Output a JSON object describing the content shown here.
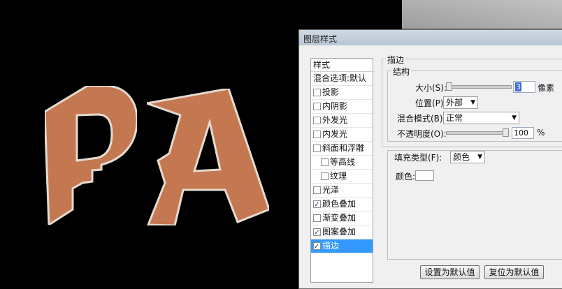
{
  "artwork": {
    "letters": "PA"
  },
  "dialog": {
    "title": "图层样式",
    "styles_header": "样式",
    "items": [
      {
        "label": "混合选项:默认",
        "checkbox": false,
        "checked": false,
        "sub": false,
        "selected": false
      },
      {
        "label": "投影",
        "checkbox": true,
        "checked": false,
        "sub": false,
        "selected": false
      },
      {
        "label": "内阴影",
        "checkbox": true,
        "checked": false,
        "sub": false,
        "selected": false
      },
      {
        "label": "外发光",
        "checkbox": true,
        "checked": false,
        "sub": false,
        "selected": false
      },
      {
        "label": "内发光",
        "checkbox": true,
        "checked": false,
        "sub": false,
        "selected": false
      },
      {
        "label": "斜面和浮雕",
        "checkbox": true,
        "checked": false,
        "sub": false,
        "selected": false
      },
      {
        "label": "等高线",
        "checkbox": true,
        "checked": false,
        "sub": true,
        "selected": false
      },
      {
        "label": "纹理",
        "checkbox": true,
        "checked": false,
        "sub": true,
        "selected": false
      },
      {
        "label": "光泽",
        "checkbox": true,
        "checked": false,
        "sub": false,
        "selected": false
      },
      {
        "label": "颜色叠加",
        "checkbox": true,
        "checked": true,
        "sub": false,
        "selected": false
      },
      {
        "label": "渐变叠加",
        "checkbox": true,
        "checked": false,
        "sub": false,
        "selected": false
      },
      {
        "label": "图案叠加",
        "checkbox": true,
        "checked": true,
        "sub": false,
        "selected": false
      },
      {
        "label": "描边",
        "checkbox": true,
        "checked": true,
        "sub": false,
        "selected": true
      }
    ],
    "stroke": {
      "section_title": "描边",
      "structure_title": "结构",
      "size_label": "大小(S):",
      "size_value": "3",
      "size_unit": "像素",
      "size_fraction": 0.03,
      "position_label": "位置(P):",
      "position_value": "外部",
      "blend_label": "混合模式(B):",
      "blend_value": "正常",
      "opacity_label": "不透明度(O):",
      "opacity_value": "100",
      "opacity_unit": "%",
      "opacity_fraction": 1.0,
      "fill_type_label": "填充类型(F):",
      "fill_type_value": "颜色",
      "color_label": "颜色:",
      "color_value": "#ffffff"
    },
    "buttons": {
      "set_default": "设置为默认值",
      "reset_default": "复位为默认值"
    }
  }
}
